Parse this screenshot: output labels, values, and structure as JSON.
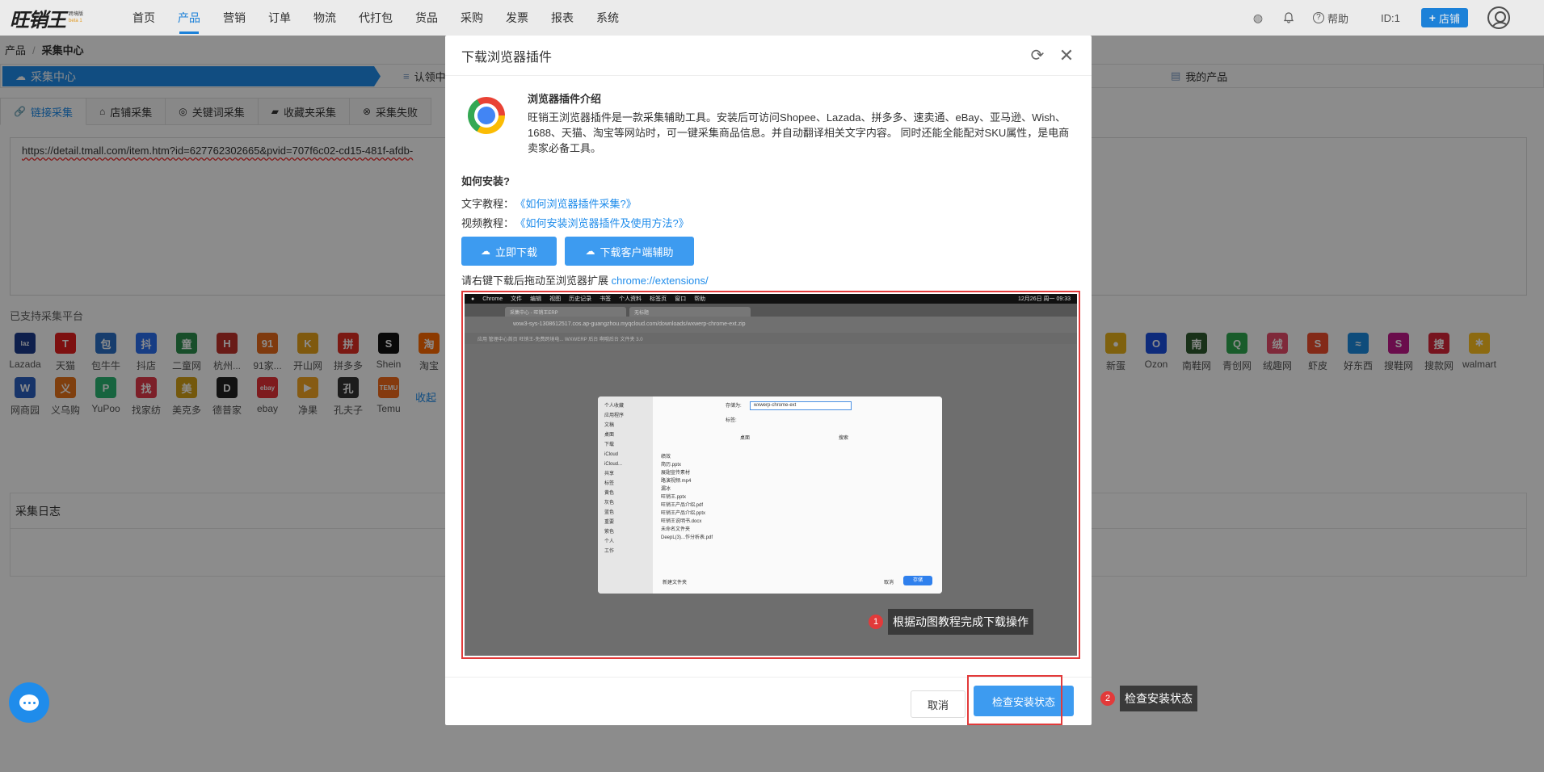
{
  "brand": {
    "name": "旺销王",
    "sub1": "跨境版",
    "sub2": "beta 1"
  },
  "nav": [
    "首页",
    "产品",
    "营销",
    "订单",
    "物流",
    "代打包",
    "货品",
    "采购",
    "发票",
    "报表",
    "系统"
  ],
  "top_right": {
    "help": "帮助",
    "uid": "ID:1",
    "shop_button": "店铺"
  },
  "breadcrumb": {
    "parent": "产品",
    "current": "采集中心"
  },
  "steps": {
    "active": "采集中心",
    "s2": "认领中",
    "s3": "我的产品"
  },
  "tabs": [
    "链接采集",
    "店铺采集",
    "关键词采集",
    "收藏夹采集",
    "采集失败"
  ],
  "url_value": "https://detail.tmall.com/item.htm?id=627762302665&pvid=707f6c02-cd15-481f-afdb-",
  "supported_title": "已支持采集平台",
  "platforms_row1_left": [
    {
      "label": "Lazada",
      "glyph": "laz",
      "color": "#1a3a8a"
    },
    {
      "label": "天猫",
      "glyph": "T",
      "color": "#e41e1e"
    },
    {
      "label": "包牛牛",
      "glyph": "包",
      "color": "#2a6fc7"
    },
    {
      "label": "抖店",
      "glyph": "抖",
      "color": "#2b6ff0"
    },
    {
      "label": "二童网",
      "glyph": "童",
      "color": "#2d8f4e"
    },
    {
      "label": "杭州...",
      "glyph": "H",
      "color": "#c0322b"
    },
    {
      "label": "91家...",
      "glyph": "91",
      "color": "#e86a1a"
    },
    {
      "label": "开山网",
      "glyph": "K",
      "color": "#e8a21a"
    },
    {
      "label": "拼多多",
      "glyph": "拼",
      "color": "#e02e24"
    },
    {
      "label": "Shein",
      "glyph": "S",
      "color": "#111111"
    },
    {
      "label": "淘宝",
      "glyph": "淘",
      "color": "#ff6a00"
    }
  ],
  "platforms_row1_right": [
    {
      "label": "新蛋",
      "glyph": "●",
      "color": "#e8b11a"
    },
    {
      "label": "Ozon",
      "glyph": "O",
      "color": "#1a4fe0"
    },
    {
      "label": "南鞋网",
      "glyph": "南",
      "color": "#2e5a2e"
    },
    {
      "label": "青创网",
      "glyph": "Q",
      "color": "#2fa84f"
    },
    {
      "label": "绒趣网",
      "glyph": "绒",
      "color": "#e84c6a"
    },
    {
      "label": "虾皮",
      "glyph": "S",
      "color": "#ee4d2d"
    },
    {
      "label": "好东西",
      "glyph": "≈",
      "color": "#1a8ae0"
    },
    {
      "label": "搜鞋网",
      "glyph": "S",
      "color": "#c2188a"
    },
    {
      "label": "搜款网",
      "glyph": "搜",
      "color": "#d9263a"
    },
    {
      "label": "walmart",
      "glyph": "✱",
      "color": "#ffc220"
    }
  ],
  "platforms_row2": [
    {
      "label": "网商园",
      "glyph": "W",
      "color": "#2a5fc0"
    },
    {
      "label": "义乌购",
      "glyph": "义",
      "color": "#e8741a"
    },
    {
      "label": "YuPoo",
      "glyph": "P",
      "color": "#2bb673"
    },
    {
      "label": "找家纺",
      "glyph": "找",
      "color": "#e23a4a"
    },
    {
      "label": "美克多",
      "glyph": "美",
      "color": "#d4a017"
    },
    {
      "label": "德普家",
      "glyph": "D",
      "color": "#222222"
    },
    {
      "label": "ebay",
      "glyph": "ebay",
      "color": "#e53238"
    },
    {
      "label": "净果",
      "glyph": "▶",
      "color": "#f5a623"
    },
    {
      "label": "孔夫子",
      "glyph": "孔",
      "color": "#333333"
    },
    {
      "label": "Temu",
      "glyph": "TEMU",
      "color": "#f26a1b"
    }
  ],
  "collapse_link": "收起",
  "log_title": "采集日志",
  "modal": {
    "title": "下载浏览器插件",
    "intro_title": "浏览器插件介绍",
    "intro_text": "旺销王浏览器插件是一款采集辅助工具。安装后可访问Shopee、Lazada、拼多多、速卖通、eBay、亚马逊、Wish、1688、天猫、淘宝等网站时，可一键采集商品信息。并自动翻译相关文字内容。 同时还能全能配对SKU属性，是电商卖家必备工具。",
    "how_title": "如何安装?",
    "text_tutorial_label": "文字教程：",
    "text_tutorial_link": "《如何浏览器插件采集?》",
    "video_tutorial_label": "视频教程：",
    "video_tutorial_link": "《如何安装浏览器插件及使用方法?》",
    "download_now": "立即下载",
    "download_client": "下载客户端辅助",
    "drag_tip": "请右键下载后拖动至浏览器扩展 ",
    "drag_link": "chrome://extensions/",
    "tip1": "根据动图教程完成下载操作",
    "tip1_num": "1",
    "cancel": "取消",
    "check": "检查安装状态",
    "tip2": "检查安装状态",
    "tip2_num": "2"
  },
  "gif": {
    "menubar": [
      "Chrome",
      "文件",
      "编辑",
      "视图",
      "历史记录",
      "书签",
      "个人资料",
      "标签页",
      "窗口",
      "帮助"
    ],
    "clock": "12月26日 周一 09:33",
    "tab1": "采集中心 - 旺销王ERP",
    "tab2": "无标题",
    "url": "wxw3-sys-1308612517.cos.ap-guangzhou.myqcloud.com/downloads/wxwerp-chrome-ext.zip",
    "bookmarks": "应用  管理中心首页  旺销王-免费跨境电...  WXWERP 后台  啊哦后台  文件夹  3.0",
    "save_as_label": "存储为:",
    "save_as_value": "wxwerp-chrome-ext",
    "tags_label": "标签:",
    "location": "桌面",
    "search": "搜索",
    "sidebar": [
      "个人收藏",
      "应用程序",
      "文稿",
      "桌面",
      "下载",
      "iCloud",
      "iCloud...",
      "共享",
      "标签",
      "黄色",
      "灰色",
      "蓝色",
      "重要",
      "紫色",
      "个人",
      "工作"
    ],
    "files": [
      "绩效",
      "简历.pptx",
      "展翅宣传素材",
      "路演视频.mp4",
      "漏冰",
      "旺销王.pptx",
      "旺销王产品介绍.pdf",
      "旺销王产品介绍.pptx",
      "旺销王说明书.docx",
      "未命名文件夹",
      "DeepL(3)...作分析表.pdf"
    ],
    "new_folder": "新建文件夹",
    "cancel": "取消",
    "save": "存储"
  }
}
